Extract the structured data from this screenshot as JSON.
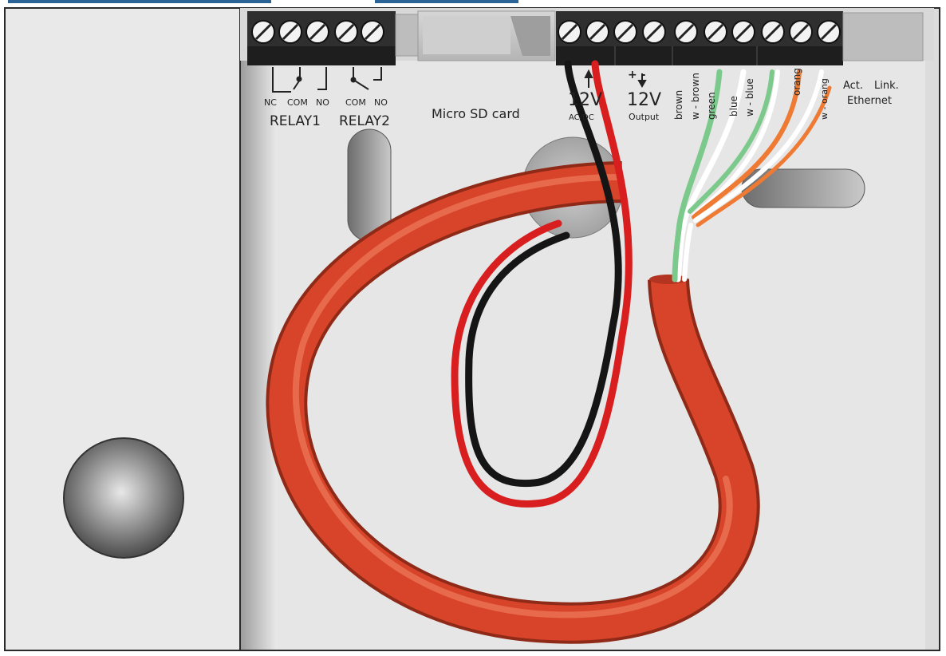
{
  "colors": {
    "enclosure": "#e9e9e9",
    "frame": "#2a2a2a",
    "terminal": "#2f2f2f",
    "cable_red": "#d8442a",
    "wire_red": "#d81e1e",
    "wire_black": "#151515",
    "wire_green": "#7cc98c",
    "wire_orange": "#ee7a33",
    "wire_white": "#ffffff",
    "header_blue": "#2a6496"
  },
  "relay1": {
    "label": "RELAY1",
    "pins": [
      "NC",
      "COM",
      "NO"
    ]
  },
  "relay2": {
    "label": "RELAY2",
    "pins": [
      "COM",
      "NO"
    ]
  },
  "sd": {
    "label": "Micro SD card"
  },
  "power_in": {
    "voltage": "12V",
    "sub": "AC/DC"
  },
  "power_out": {
    "voltage": "12V",
    "sub": "Output",
    "polarity": "+ -"
  },
  "ethernet": {
    "wires": [
      "brown",
      "w - brown",
      "green",
      "blue",
      "w - blue",
      "orang",
      "w - orang"
    ],
    "act": "Act.",
    "link": "Link.",
    "label": "Ethernet"
  }
}
